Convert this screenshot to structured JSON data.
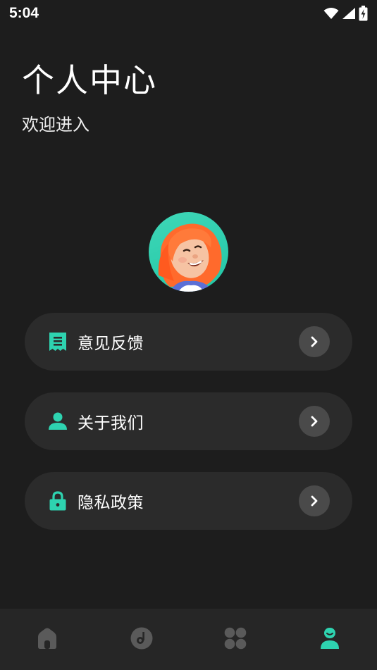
{
  "status_bar": {
    "time": "5:04",
    "icons": [
      "wifi-icon",
      "cellular-signal-icon",
      "battery-charging-icon"
    ]
  },
  "header": {
    "title": "个人中心",
    "subtitle": "欢迎进入"
  },
  "avatar": {
    "icon": "avatar-illustration"
  },
  "menu": [
    {
      "label": "意见反馈",
      "icon": "feedback-receipt-icon",
      "accent": "#2ed3b0"
    },
    {
      "label": "关于我们",
      "icon": "person-icon",
      "accent": "#2ed3b0"
    },
    {
      "label": "隐私政策",
      "icon": "lock-icon",
      "accent": "#2ed3b0"
    }
  ],
  "bottom_nav": {
    "items": [
      {
        "icon": "home-icon",
        "active": false
      },
      {
        "icon": "music-disc-icon",
        "active": false
      },
      {
        "icon": "apps-grid-icon",
        "active": false
      },
      {
        "icon": "profile-icon",
        "active": true
      }
    ],
    "active_color": "#2ed3b0",
    "inactive_color": "#5a5a5a"
  },
  "colors": {
    "background": "#1d1d1d",
    "card": "#2b2b2b",
    "chevron_bg": "#4a4a4a",
    "accent": "#2ed3b0"
  }
}
